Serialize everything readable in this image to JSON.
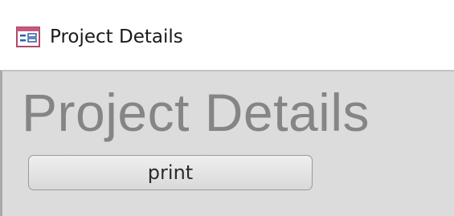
{
  "window": {
    "title": "Project Details",
    "icon": "form-icon"
  },
  "form": {
    "heading": "Project Details",
    "print_label": "print"
  }
}
